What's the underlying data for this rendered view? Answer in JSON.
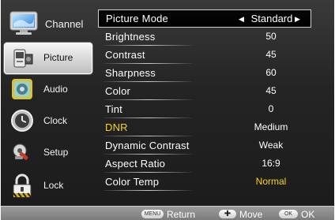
{
  "sidebar": {
    "items": [
      {
        "label": "Channel",
        "icon": "monitor-icon"
      },
      {
        "label": "Picture",
        "icon": "picture-icon"
      },
      {
        "label": "Audio",
        "icon": "audio-icon"
      },
      {
        "label": "Clock",
        "icon": "clock-icon"
      },
      {
        "label": "Setup",
        "icon": "setup-icon"
      },
      {
        "label": "Lock",
        "icon": "lock-icon"
      }
    ],
    "selected": "Picture"
  },
  "menu": {
    "rows": [
      {
        "name": "Picture Mode",
        "value": "Standard",
        "selected": true
      },
      {
        "name": "Brightness",
        "value": "50"
      },
      {
        "name": "Contrast",
        "value": "45"
      },
      {
        "name": "Sharpness",
        "value": "60"
      },
      {
        "name": "Color",
        "value": "45"
      },
      {
        "name": "Tint",
        "value": "0"
      },
      {
        "name": "DNR",
        "value": "Medium",
        "name_color": "#f7d31d"
      },
      {
        "name": "Dynamic Contrast",
        "value": "Weak"
      },
      {
        "name": "Aspect Ratio",
        "value": "16:9"
      },
      {
        "name": "Color Temp",
        "value": "Normal",
        "value_color": "#f7d31d"
      }
    ],
    "arrow_left": "◀",
    "arrow_right": "▶"
  },
  "footer": {
    "menu_key": "MENU",
    "menu_label": "Return",
    "move_key": "✚",
    "move_label": "Move",
    "ok_key": "OK",
    "ok_label": "OK"
  },
  "colors": {
    "highlight": "#f7d31d",
    "background": "#242424",
    "footer": "#8a8a8a"
  }
}
